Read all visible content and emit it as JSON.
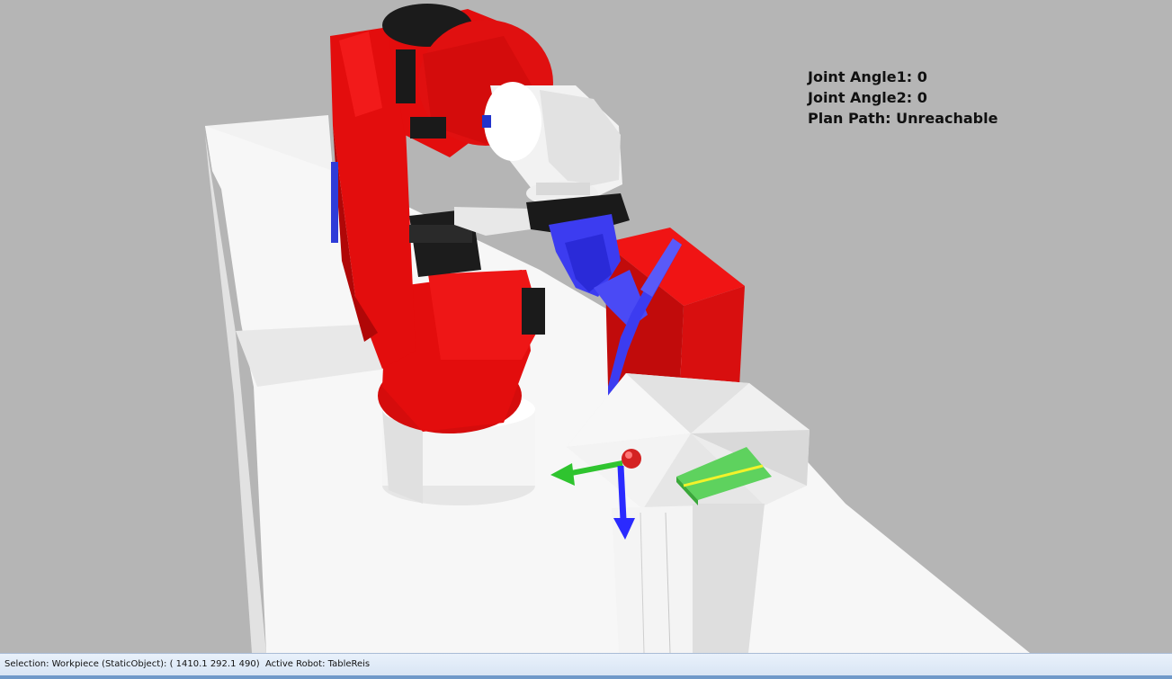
{
  "overlay": {
    "joint_angle1_label": "Joint Angle1:",
    "joint_angle1_value": "0",
    "joint_angle2_label": "Joint Angle2:",
    "joint_angle2_value": "0",
    "plan_path_label": "Plan Path:",
    "plan_path_value": "Unreachable"
  },
  "status_bar": {
    "text": "Selection: Workpiece (StaticObject): ( 1410.1 292.1 490)  Active Robot: TableReis"
  },
  "scene": {
    "robot_color": "#e30d0d",
    "torch_color": "#3c3cf0",
    "table_color": "#f4f4f4",
    "box_color": "#d80f0f",
    "workpiece_color": "#5ed25e",
    "gizmo_x_color": "#2fc42f",
    "gizmo_y_color": "#2a2aff",
    "gizmo_origin_color": "#d42222"
  }
}
